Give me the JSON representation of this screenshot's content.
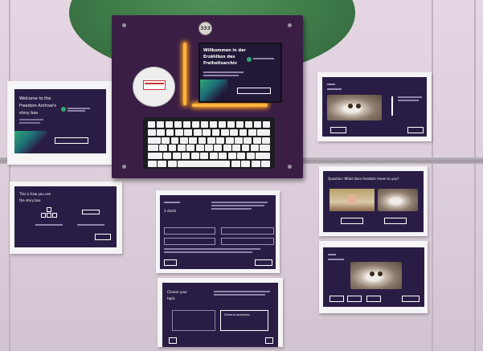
{
  "colors": {
    "wall": "#d8cbd7",
    "screen_purple": "#2a1d45",
    "kiosk_frame": "#3b1e44",
    "neon": "#ffb43a",
    "accent_green": "#2fa873"
  },
  "kiosk": {
    "speaker_label": "333",
    "screen": {
      "title_line1": "Willkommen in der",
      "title_line2": "Erzählbox des",
      "title_line3": "Freiheitsarchiv"
    }
  },
  "sheets": {
    "welcome": {
      "title_line1": "Welcome to the",
      "title_line2": "Freedom Archive's",
      "title_line3": "story box"
    },
    "question": {
      "title": "Question: What does freedom mean to you?"
    },
    "topic": {
      "title_line1": "Choose your",
      "title_line2": "topic",
      "option_right": "General questions"
    },
    "start": {
      "count": "3 starts"
    },
    "usage": {
      "title_line1": "This is how you use",
      "title_line2": "the story box"
    }
  }
}
